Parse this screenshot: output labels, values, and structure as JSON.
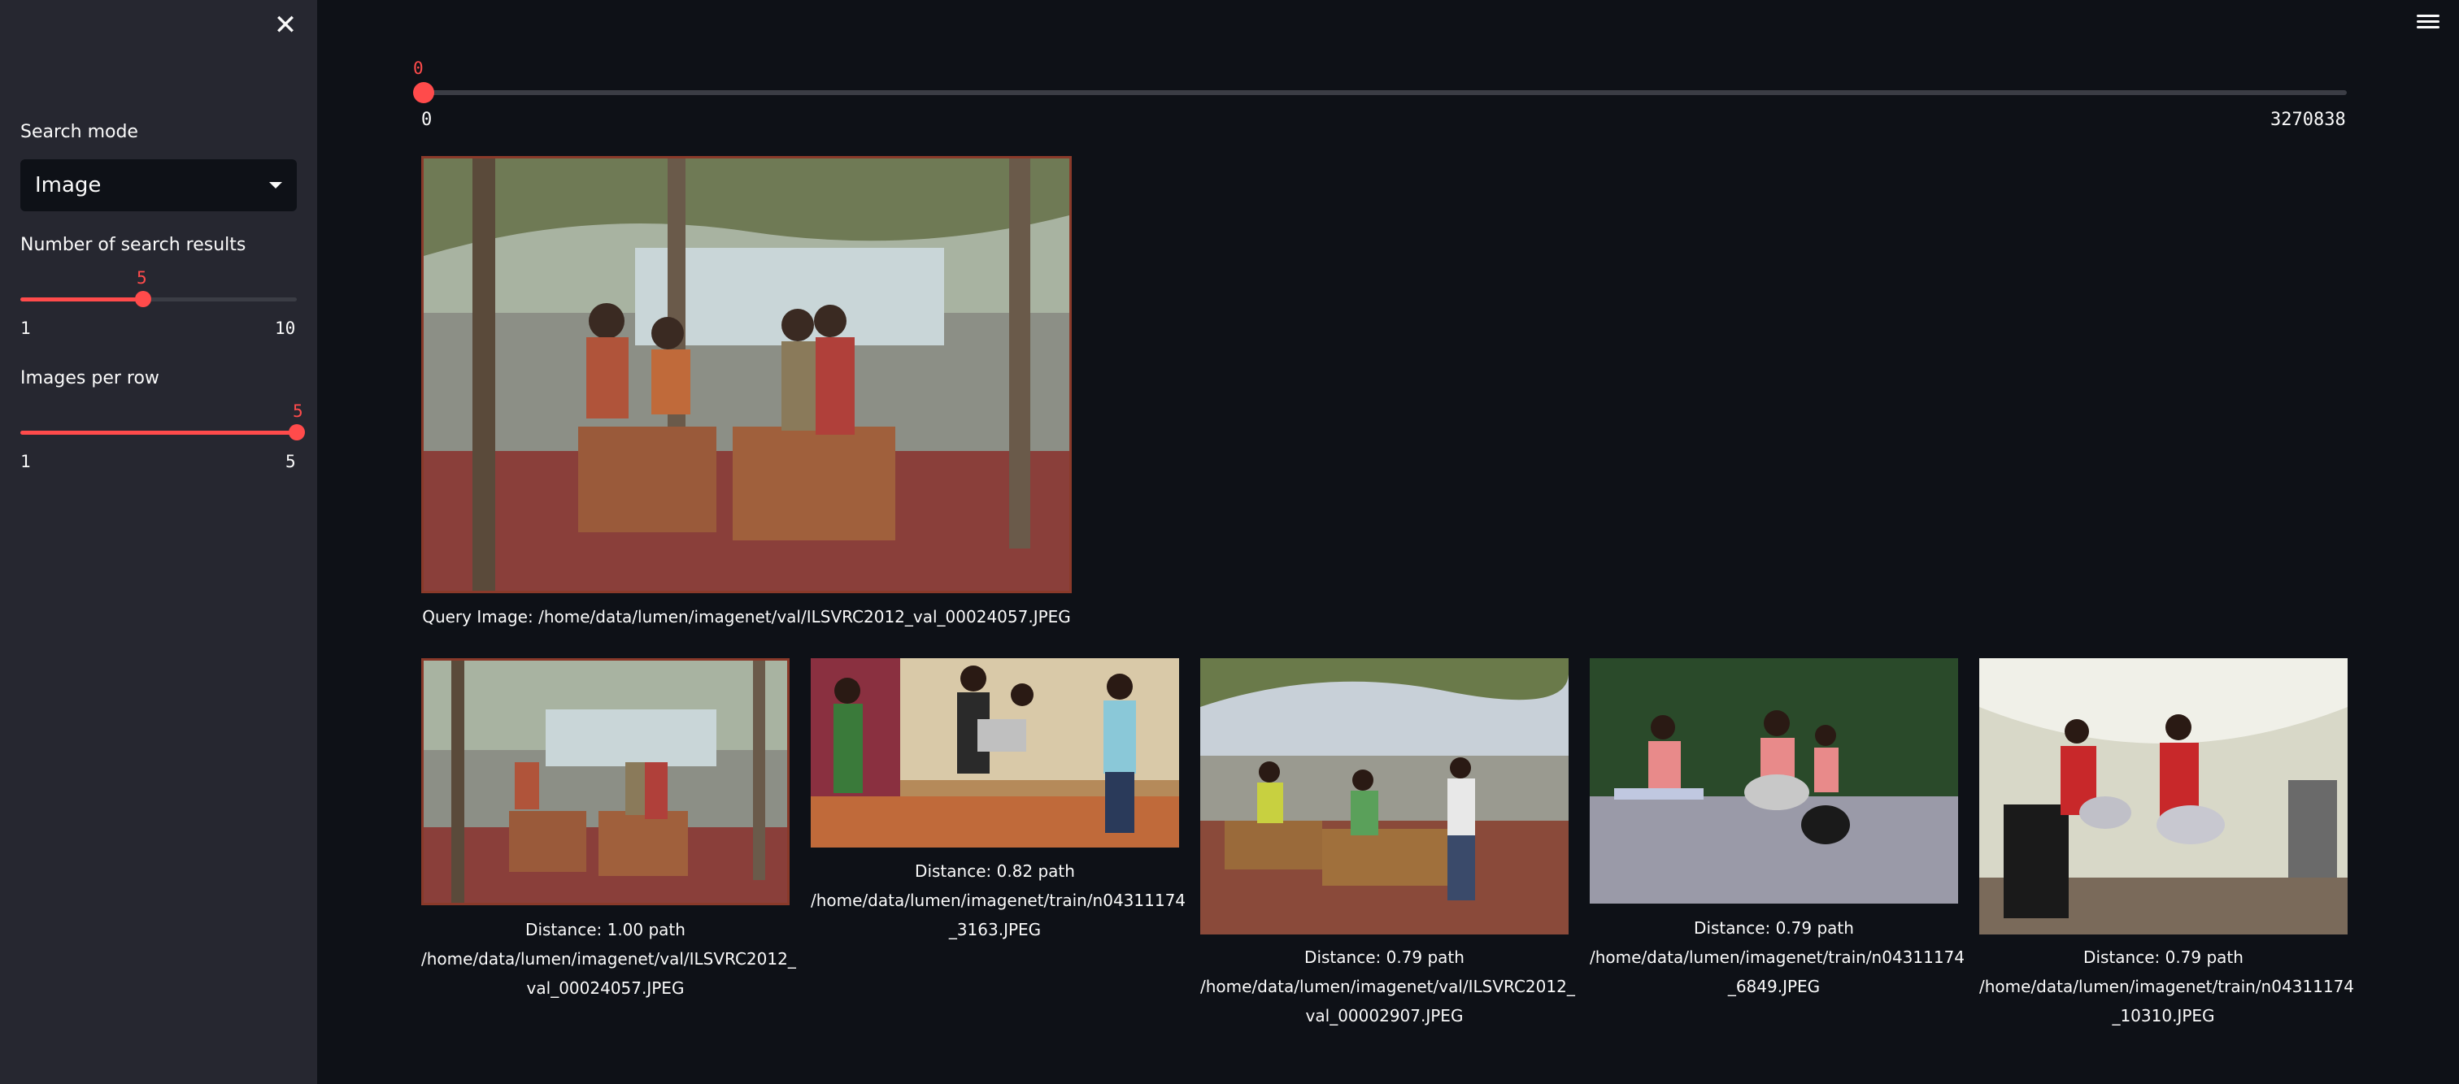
{
  "sidebar": {
    "close_icon": "close-icon",
    "search_mode": {
      "label": "Search mode",
      "value": "Image"
    },
    "num_results": {
      "label": "Number of search results",
      "min": "1",
      "max": "10",
      "value": "5",
      "fraction": 0.444
    },
    "images_per_row": {
      "label": "Images per row",
      "min": "1",
      "max": "5",
      "value": "5",
      "fraction": 1.0
    }
  },
  "header": {
    "menu_icon": "hamburger-menu-icon"
  },
  "index_slider": {
    "value": "0",
    "min": "0",
    "max": "3270838",
    "fraction": 0.0
  },
  "query": {
    "caption": "Query Image: /home/data/lumen/imagenet/val/ILSVRC2012_val_00024057.JPEG"
  },
  "results": [
    {
      "distance": "Distance: 1.00 path",
      "path1": "/home/data/lumen/imagenet/val/ILSVRC2012_",
      "path2": "val_00024057.JPEG"
    },
    {
      "distance": "Distance: 0.82 path",
      "path1": "/home/data/lumen/imagenet/train/n04311174",
      "path2": "_3163.JPEG"
    },
    {
      "distance": "Distance: 0.79 path",
      "path1": "/home/data/lumen/imagenet/val/ILSVRC2012_",
      "path2": "val_00002907.JPEG"
    },
    {
      "distance": "Distance: 0.79 path",
      "path1": "/home/data/lumen/imagenet/train/n04311174",
      "path2": "_6849.JPEG"
    },
    {
      "distance": "Distance: 0.79 path",
      "path1": "/home/data/lumen/imagenet/train/n04311174",
      "path2": "_10310.JPEG"
    }
  ],
  "colors": {
    "accent": "#ff4b4b",
    "background": "#0e1117",
    "sidebar": "#262730"
  }
}
